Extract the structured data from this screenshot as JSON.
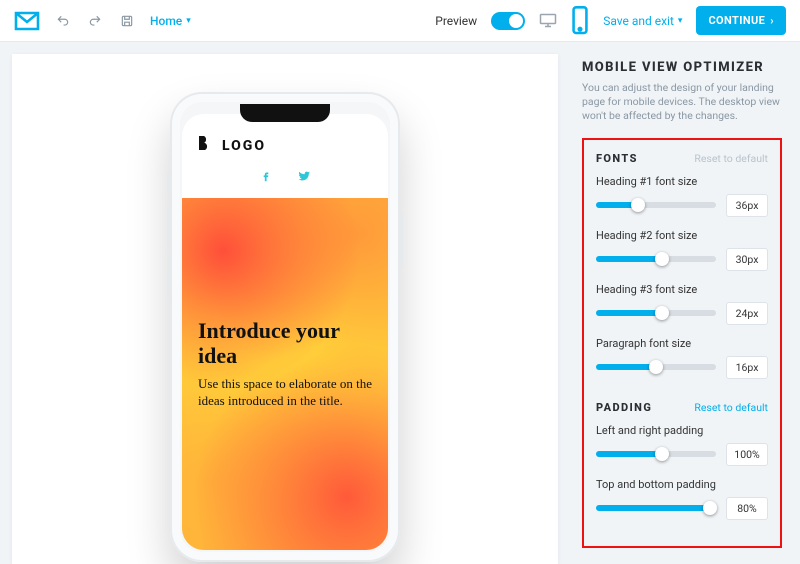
{
  "topbar": {
    "home": "Home",
    "preview_label": "Preview",
    "save_exit": "Save and exit",
    "continue": "CONTINUE"
  },
  "phone": {
    "logo_text": "LOGO",
    "hero_title": "Introduce your idea",
    "hero_body": "Use this space to elaborate on the ideas introduced in the title."
  },
  "panel": {
    "title": "MOBILE VIEW OPTIMIZER",
    "description": "You can adjust the design of your landing page for mobile devices. The desktop view won't be affected by the changes.",
    "fonts": {
      "title": "FONTS",
      "reset": "Reset to default",
      "items": [
        {
          "label": "Heading #1 font size",
          "value": "36px",
          "fill": 35
        },
        {
          "label": "Heading #2 font size",
          "value": "30px",
          "fill": 55
        },
        {
          "label": "Heading #3 font size",
          "value": "24px",
          "fill": 55
        },
        {
          "label": "Paragraph font size",
          "value": "16px",
          "fill": 50
        }
      ]
    },
    "padding": {
      "title": "PADDING",
      "reset": "Reset to default",
      "items": [
        {
          "label": "Left and right padding",
          "value": "100%",
          "fill": 55
        },
        {
          "label": "Top and bottom padding",
          "value": "80%",
          "fill": 95
        }
      ]
    }
  }
}
